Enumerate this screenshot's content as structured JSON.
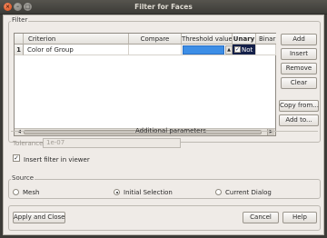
{
  "window": {
    "title": "Filter for Faces",
    "close_glyph": "×",
    "minimize_glyph": "–",
    "maximize_glyph": "□"
  },
  "filter": {
    "group_label": "Filter",
    "columns": [
      "Criterion",
      "Compare",
      "Threshold value",
      "Unary",
      "Binar"
    ],
    "rows": [
      {
        "index": "1",
        "criterion": "Color of Group",
        "compare": "",
        "threshold": "",
        "unary_checked": true,
        "unary": "Not",
        "binary": ""
      }
    ],
    "buttons": {
      "add": "Add",
      "insert": "Insert",
      "remove": "Remove",
      "clear": "Clear",
      "copy_from": "Copy from...",
      "add_to": "Add to..."
    }
  },
  "additional_parameters": {
    "section_label": "Additional parameters",
    "tolerance_label": "Tolerance",
    "tolerance_value": "1e-07",
    "insert_in_viewer_label": "Insert filter in viewer",
    "insert_in_viewer_checked": true
  },
  "source": {
    "group_label": "Source",
    "options": [
      {
        "label": "Mesh",
        "selected": false
      },
      {
        "label": "Initial Selection",
        "selected": true
      },
      {
        "label": "Current Dialog",
        "selected": false
      }
    ]
  },
  "footer": {
    "apply_close": "Apply and Close",
    "cancel": "Cancel",
    "help": "Help"
  },
  "colors": {
    "threshold_cell": "#3d8ee6",
    "unary_cell": "#14204a",
    "close_button": "#e2561f"
  }
}
